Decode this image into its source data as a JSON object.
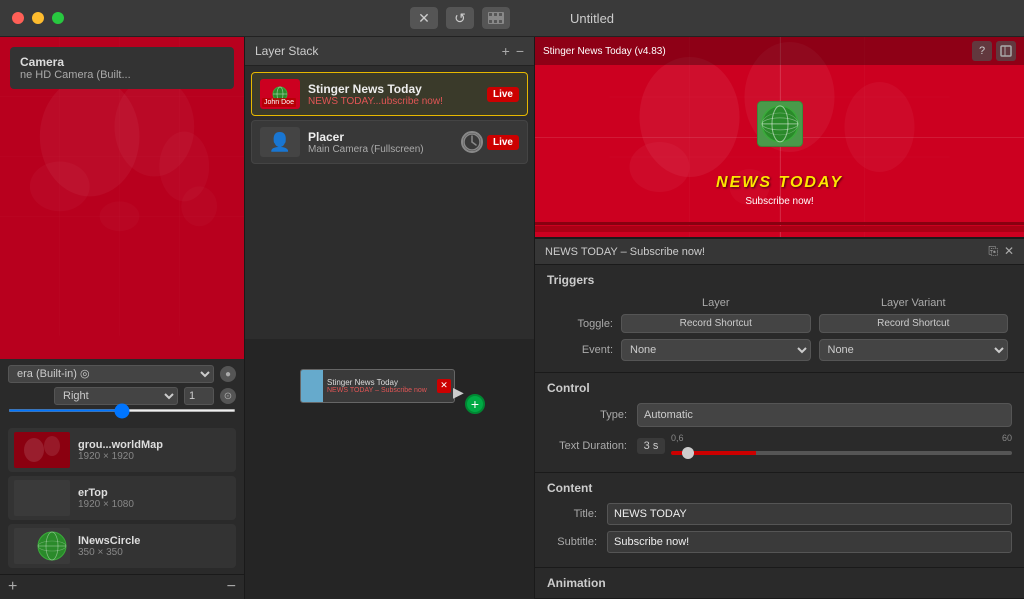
{
  "window": {
    "title": "Untitled",
    "controls": [
      "close",
      "minimize",
      "fullscreen"
    ]
  },
  "toolbar": {
    "close_icon": "✕",
    "refresh_icon": "↺",
    "film_icon": "🎬"
  },
  "left_panel": {
    "camera_label": "Camera",
    "camera_sub": "ne HD Camera (Built...",
    "settings": {
      "direction": "Right",
      "value": "1"
    },
    "thumbnails": [
      {
        "name": "grou...worldMap",
        "size": "1920 × 1920"
      },
      {
        "name": "erTop",
        "size": "1920 × 1080"
      },
      {
        "name": "lNewsCircle",
        "size": "350 × 350"
      }
    ]
  },
  "layer_stack": {
    "title": "Layer Stack",
    "add_btn": "+",
    "remove_btn": "−",
    "layers": [
      {
        "name": "Stinger News Today",
        "subtitle": "NEWS TODAY...ubscribe now!",
        "badge": "Live",
        "type": "stinger",
        "tag": "John Doe"
      },
      {
        "name": "Placer",
        "subtitle": "Main Camera (Fullscreen)",
        "badge": "Live",
        "type": "placer"
      }
    ]
  },
  "node_area": {
    "node1": {
      "name": "Stinger News Today",
      "subtitle": "NEWS TODAY – Subscribe now"
    }
  },
  "right_panel": {
    "preview": {
      "top_bar_title": "Stinger News Today (v4.83)",
      "preview_title": "NEWS TODAY",
      "preview_subtitle": "Subscribe now!"
    },
    "info_bar": {
      "title": "NEWS TODAY – Subscribe now!"
    },
    "triggers": {
      "section_title": "Triggers",
      "col_layer": "Layer",
      "col_variant": "Layer Variant",
      "toggle_label": "Toggle:",
      "event_label": "Event:",
      "toggle_layer_btn": "Record Shortcut",
      "toggle_variant_btn": "Record Shortcut",
      "event_layer_value": "None",
      "event_variant_value": "None"
    },
    "control": {
      "section_title": "Control",
      "type_label": "Type:",
      "type_value": "Automatic",
      "duration_label": "Text Duration:",
      "duration_value": "3 s",
      "slider_min": "0,6",
      "slider_max": "60"
    },
    "content": {
      "section_title": "Content",
      "title_label": "Title:",
      "title_value": "NEWS TODAY",
      "subtitle_label": "Subtitle:",
      "subtitle_value": "Subscribe now!"
    },
    "animation": {
      "section_title": "Animation"
    }
  }
}
